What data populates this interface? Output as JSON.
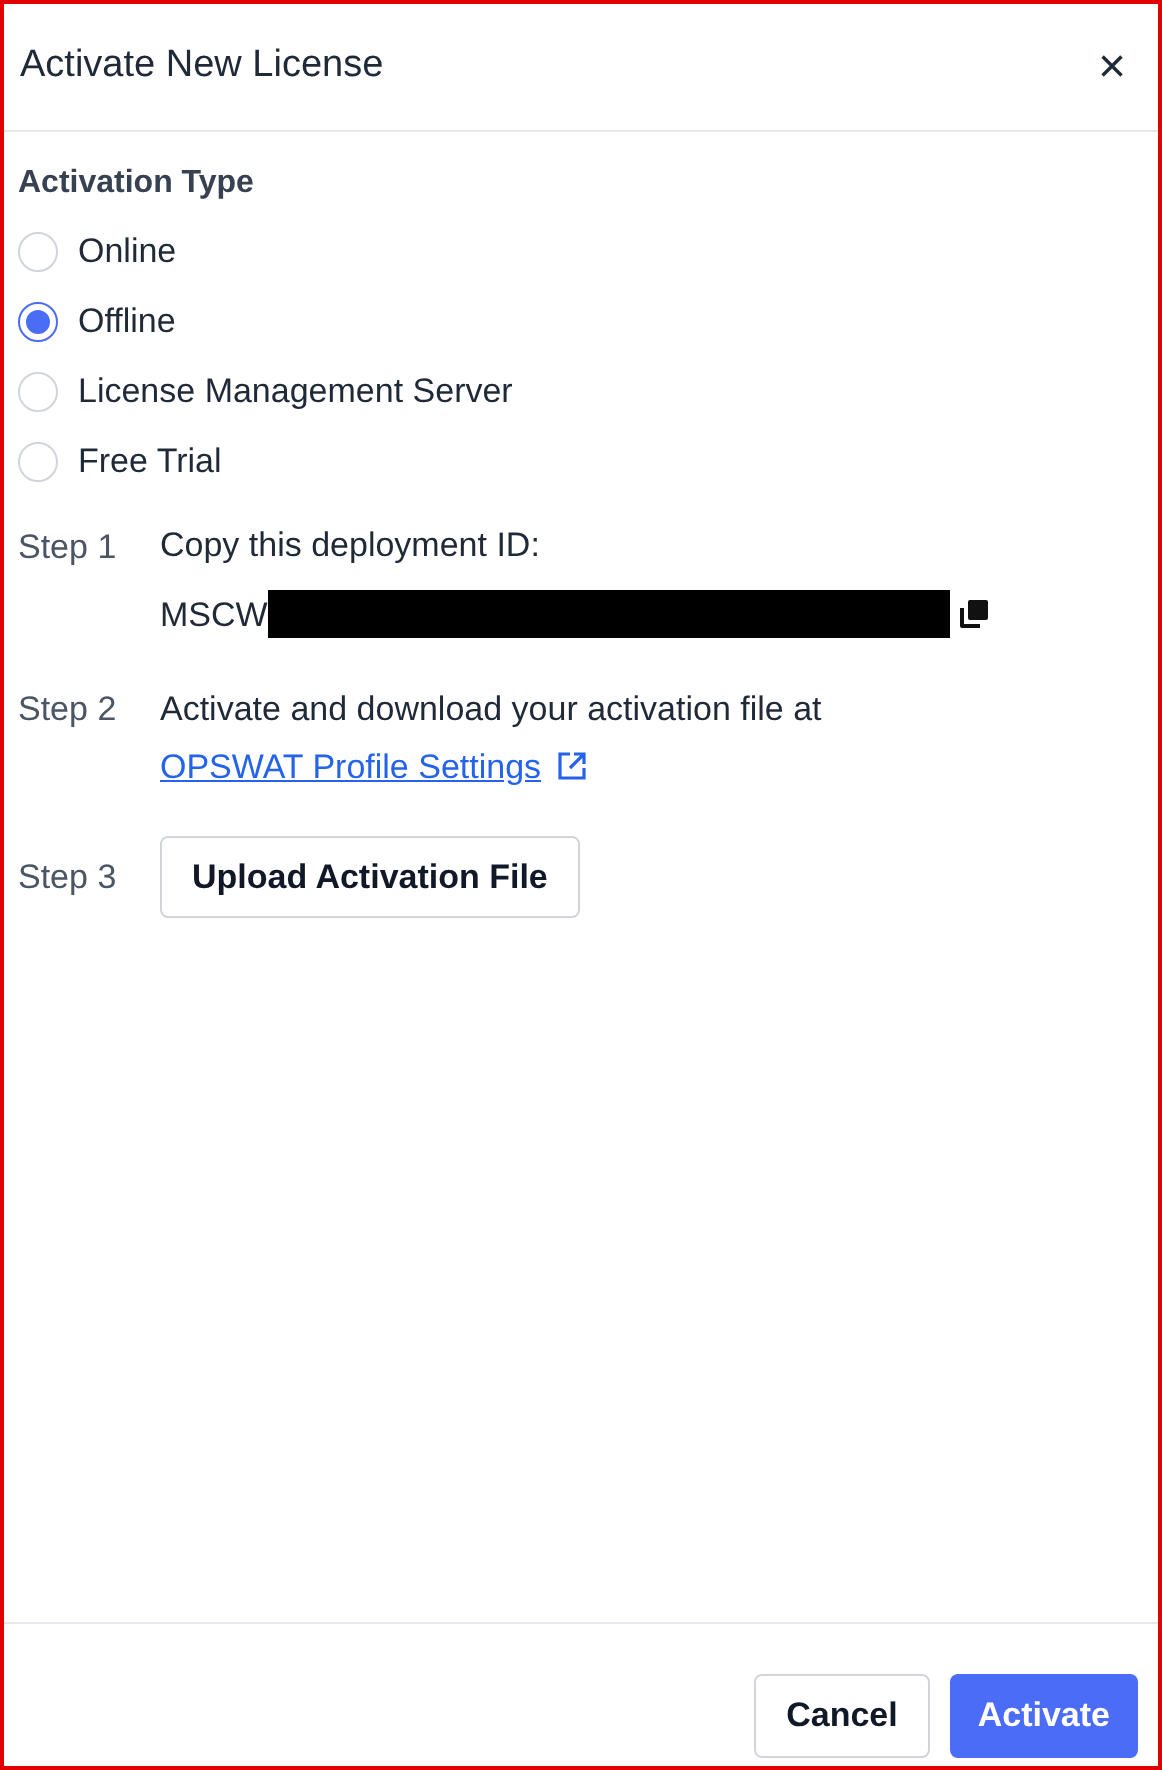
{
  "dialog": {
    "title": "Activate New License",
    "close": "×"
  },
  "activation_type": {
    "label": "Activation Type",
    "options": [
      {
        "label": "Online",
        "selected": false
      },
      {
        "label": "Offline",
        "selected": true
      },
      {
        "label": "License Management Server",
        "selected": false
      },
      {
        "label": "Free Trial",
        "selected": false
      }
    ]
  },
  "steps": [
    {
      "kind": "copy",
      "step": "Step 1",
      "text": "Copy this deployment ID:",
      "value": "MSCW"
    },
    {
      "kind": "link",
      "step": "Step 2",
      "text": "Activate and download your activation file at",
      "link": "OPSWAT Profile Settings"
    },
    {
      "kind": "button",
      "step": "Step 3",
      "button": "Upload Activation File"
    }
  ],
  "buttons": [
    {
      "label": "Cancel",
      "kind": "secondary"
    },
    {
      "label": "Activate",
      "kind": "primary"
    }
  ]
}
